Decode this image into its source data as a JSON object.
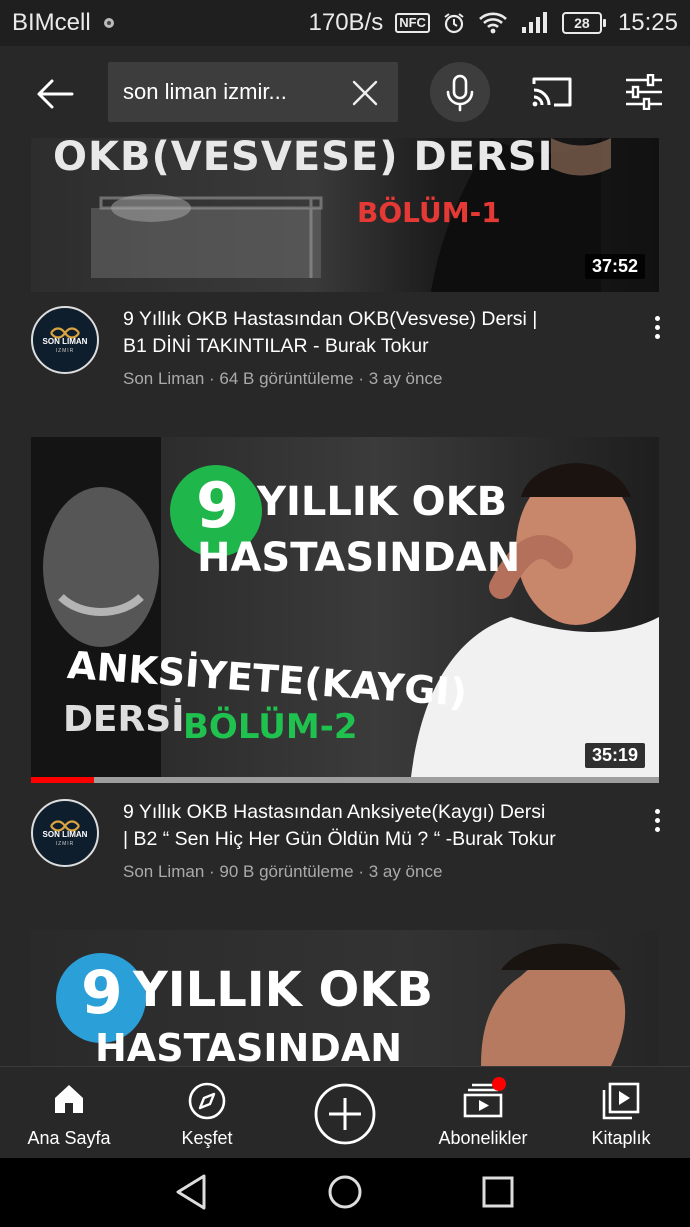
{
  "status_bar": {
    "carrier": "BIMcell",
    "network_speed": "170B/s",
    "nfc": "NFC",
    "battery": "28",
    "time": "15:25"
  },
  "search": {
    "query": "son liman izmir..."
  },
  "videos": [
    {
      "thumb_text": [
        "OKB(VESVESE) DERSI",
        "BÖLÜM-1"
      ],
      "duration": "37:52",
      "title_line1": "9 Yıllık OKB Hastasından OKB(Vesvese) Dersi |",
      "title_line2": "B1 DİNİ TAKINTILAR - Burak Tokur",
      "channel": "Son Liman",
      "views": "64 B görüntüleme",
      "age": "3 ay önce",
      "avatar_label": "SON LIMAN",
      "avatar_sub": "IZMIR"
    },
    {
      "thumb_text": [
        "9",
        "YILLIK OKB",
        "HASTASINDAN",
        "ANKSİYETE(KAYGI)",
        "DERSİ",
        "BÖLÜM-2"
      ],
      "duration": "35:19",
      "watched_progress": 0.1,
      "title_line1": "9 Yıllık OKB Hastasından Anksiyete(Kaygı) Dersi",
      "title_line2": "| B2 “ Sen Hiç Her Gün Öldün Mü ? “ -Burak Tokur",
      "channel": "Son Liman",
      "views": "90 B görüntüleme",
      "age": "3 ay önce",
      "avatar_label": "SON LIMAN",
      "avatar_sub": "IZMIR"
    },
    {
      "thumb_text": [
        "9",
        "YILLIK OKB",
        "HASTASINDAN"
      ]
    }
  ],
  "bottom_nav": [
    {
      "label": "Ana Sayfa",
      "icon": "home-icon"
    },
    {
      "label": "Keşfet",
      "icon": "compass-icon"
    },
    {
      "label": "",
      "icon": "add-icon"
    },
    {
      "label": "Abonelikler",
      "icon": "subscriptions-icon"
    },
    {
      "label": "Kitaplık",
      "icon": "library-icon"
    }
  ],
  "colors": {
    "background": "#282828",
    "accent_red": "#ff0000",
    "green": "#1fb64b",
    "blue": "#2a9fd8"
  }
}
